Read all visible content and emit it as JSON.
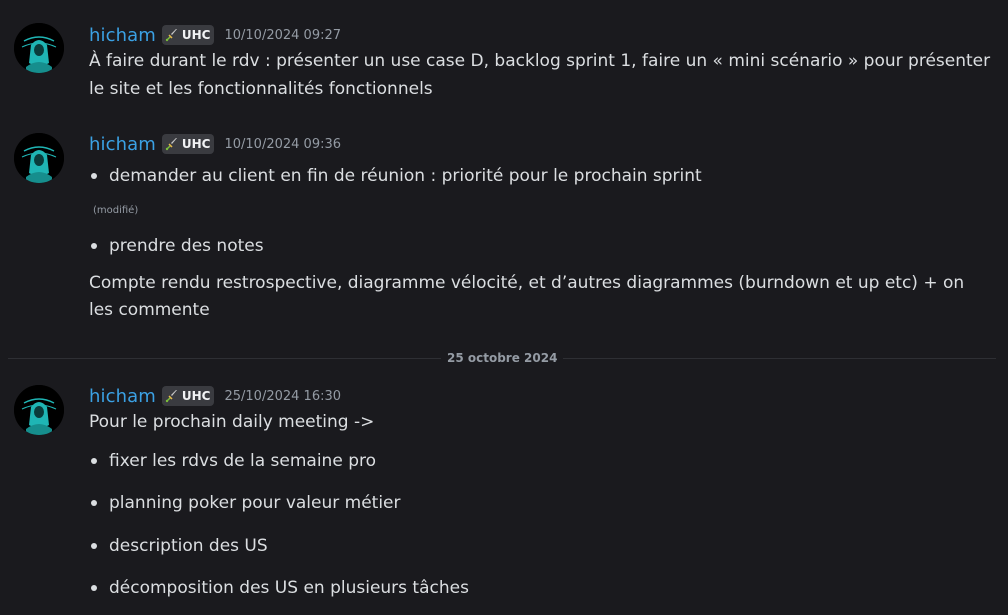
{
  "messages": [
    {
      "author": "hicham",
      "tag": "UHC",
      "timestamp": "10/10/2024 09:27",
      "lines": [
        "À faire durant le rdv : présenter un use case D, backlog sprint 1, faire un « mini scénario » pour présenter",
        "le site et les fonctionnalités fonctionnels"
      ]
    },
    {
      "author": "hicham",
      "tag": "UHC",
      "timestamp": "10/10/2024 09:36",
      "bullets_a": [
        "demander au client en fin de réunion : priorité pour le prochain sprint"
      ],
      "edited_label": "(modifié)",
      "bullets_b": [
        "prendre des notes"
      ],
      "lines": [
        "Compte rendu restrospective, diagramme vélocité, et d’autres diagrammes (burndown et up etc) + on",
        "les commente"
      ]
    },
    {
      "author": "hicham",
      "tag": "UHC",
      "timestamp": "25/10/2024 16:30",
      "intro": "Pour le prochain daily meeting ->",
      "bullets": [
        "fixer les rdvs de la semaine pro",
        "planning poker pour valeur métier",
        "description des US",
        "décomposition des US en plusieurs tâches"
      ]
    }
  ],
  "date_divider": "25 octobre 2024",
  "colors": {
    "background": "#1a1a1e",
    "username": "#3ba1e4",
    "text": "#dbdee1",
    "muted": "#949ba4",
    "avatar_figure": "#1fb5b4"
  },
  "icons": {
    "avatar": "hooded-figure-avatar",
    "tag_badge": "sword-icon"
  }
}
